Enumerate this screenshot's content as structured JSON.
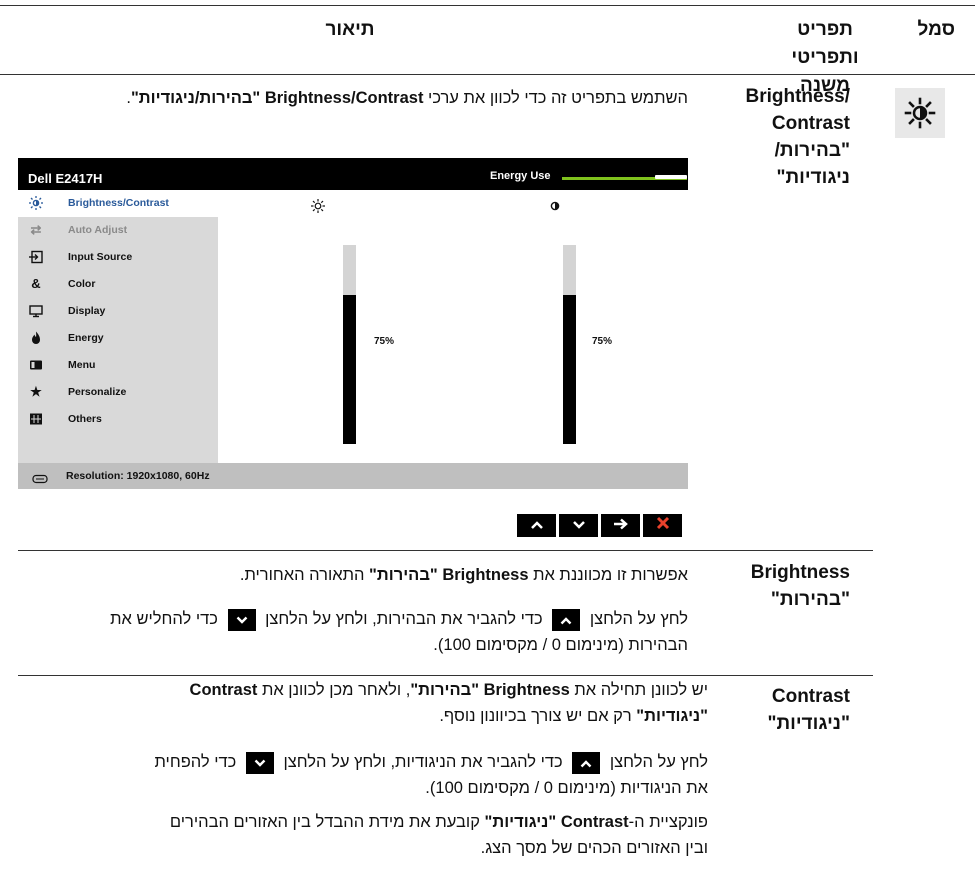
{
  "header": {
    "col_icon": "סמל",
    "col_submenu": "תפריט ותפריטי משנה",
    "col_desc": "תיאור"
  },
  "row1": {
    "param_en": "Brightness/ Contrast",
    "param_he": "\"בהירות/ ניגודיות\"",
    "desc_pre": "השתמש בתפריט זה כדי לכוון את ערכי ",
    "desc_bold": "Brightness/Contrast \"בהירות/ניגודיות\"",
    "desc_post": ".",
    "icon": "brightness-sun-icon"
  },
  "osd": {
    "model": "Dell E2417H",
    "energy_label": "Energy Use",
    "energy_level": 0.8,
    "menu_items": [
      {
        "label": "Brightness/Contrast",
        "icon": "sun-icon",
        "selected": true
      },
      {
        "label": "Auto Adjust",
        "icon": "auto-adjust-icon",
        "disabled": true
      },
      {
        "label": "Input Source",
        "icon": "input-source-icon"
      },
      {
        "label": "Color",
        "icon": "color-icon"
      },
      {
        "label": "Display",
        "icon": "display-icon"
      },
      {
        "label": "Energy",
        "icon": "energy-icon"
      },
      {
        "label": "Menu",
        "icon": "menu-icon"
      },
      {
        "label": "Personalize",
        "icon": "star-icon"
      },
      {
        "label": "Others",
        "icon": "others-icon"
      }
    ],
    "brightness_value": "75%",
    "contrast_value": "75%",
    "brightness_level": 0.75,
    "contrast_level": 0.75,
    "footer": "Resolution: 1920x1080, 60Hz",
    "nav_buttons": [
      "up-arrow-icon",
      "down-arrow-icon",
      "right-arrow-icon",
      "close-x-icon"
    ]
  },
  "row2": {
    "param_en": "Brightness",
    "param_he": "\"בהירות\"",
    "p1_pre": "אפשרות זו מכווננת את ",
    "p1_bold": "Brightness \"בהירות\"",
    "p1_post": " התאורה האחורית.",
    "p2_a": "לחץ על הלחצן",
    "p2_b": "כדי להגביר את הבהירות, ולחץ על הלחצן",
    "p2_c": "כדי להחליש את",
    "p2_d": "הבהירות (מינימום 0 / מקסימום 100)."
  },
  "row3": {
    "param_en": "Contrast",
    "param_he": "\"ניגודיות\"",
    "p1_pre": "יש לכוונן תחילה את ",
    "p1_bold": "Brightness \"בהירות\"",
    "p1_mid": ", ולאחר מכן לכוונן את ",
    "p1_bold2": "Contrast",
    "p1_bold3": "\"ניגודיות\"",
    "p1_post": " רק אם יש צורך בכיוונון נוסף.",
    "p2_a": "לחץ על הלחצן",
    "p2_b": "כדי להגביר את הניגודיות, ולחץ על הלחצן",
    "p2_c": "כדי להפחית",
    "p2_d": "את הניגודיות (מינימום 0 / מקסימום 100).",
    "p3_pre": "פונקציית ה-",
    "p3_bold": "Contrast \"ניגודיות\"",
    "p3_post": " קובעת את מידת ההבדל בין האזורים הבהירים",
    "p3_line2": "ובין האזורים הכהים של מסך הצג."
  }
}
